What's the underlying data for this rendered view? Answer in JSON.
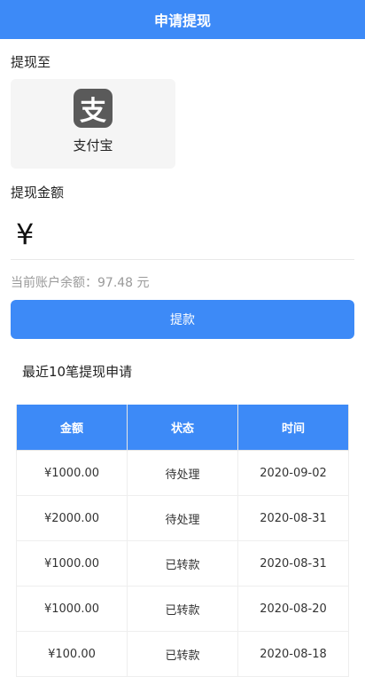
{
  "header": {
    "title": "申请提现"
  },
  "withdraw_to": {
    "label": "提现至",
    "method": {
      "name": "支付宝",
      "icon": "alipay-icon",
      "glyph": "支"
    }
  },
  "amount": {
    "label": "提现金额",
    "currency_symbol": "¥",
    "value": ""
  },
  "balance": {
    "text": "当前账户余额：97.48 元"
  },
  "submit_button": {
    "label": "提款"
  },
  "recent": {
    "title": "最近10笔提现申请",
    "columns": [
      "金额",
      "状态",
      "时间"
    ],
    "rows": [
      {
        "amount": "¥1000.00",
        "status": "待处理",
        "date": "2020-09-02"
      },
      {
        "amount": "¥2000.00",
        "status": "待处理",
        "date": "2020-08-31"
      },
      {
        "amount": "¥1000.00",
        "status": "已转款",
        "date": "2020-08-31"
      },
      {
        "amount": "¥1000.00",
        "status": "已转款",
        "date": "2020-08-20"
      },
      {
        "amount": "¥100.00",
        "status": "已转款",
        "date": "2020-08-18"
      }
    ]
  },
  "colors": {
    "accent": "#3d8af7",
    "logo_bg": "#5a5a5a",
    "muted_text": "#9a9a9a"
  }
}
